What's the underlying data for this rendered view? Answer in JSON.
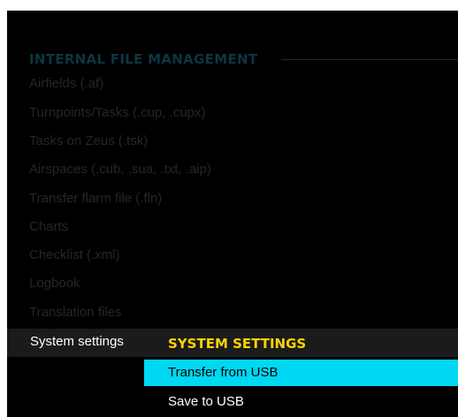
{
  "internal_file_management": {
    "header": "INTERNAL FILE MANAGEMENT",
    "items": [
      "Airfields (.af)",
      "Turnpoints/Tasks (.cup, .cupx)",
      "Tasks on Zeus (.tsk)",
      "Airspaces (.cub, .sua, .txt, .aip)",
      "Transfer flarm file (.fln)",
      "Charts",
      "Checklist (.xml)",
      "Logbook",
      "Translation files"
    ],
    "selected_item": "System settings"
  },
  "system_settings_submenu": {
    "title": "SYSTEM SETTINGS",
    "options": [
      {
        "label": "Transfer from USB",
        "highlighted": true
      },
      {
        "label": "Save to USB",
        "highlighted": false
      }
    ]
  },
  "colors": {
    "background": "#000000",
    "header": "#0c3640",
    "dim_item": "#262626",
    "submenu_title": "#ffd400",
    "highlight": "#00d7f2"
  }
}
